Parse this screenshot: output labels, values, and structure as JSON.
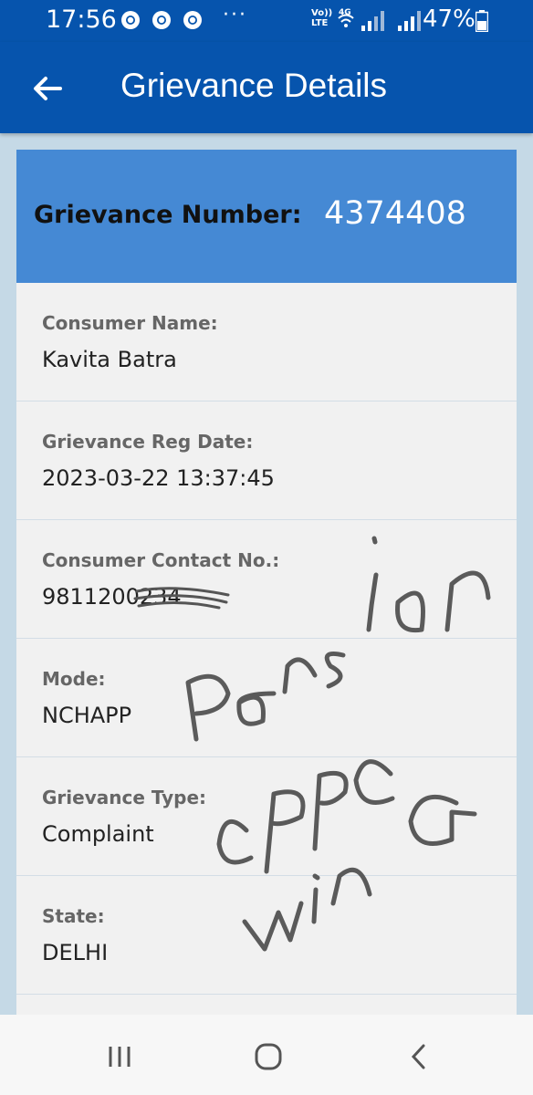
{
  "status_bar": {
    "time": "17:56",
    "more": "···",
    "volte_top": "Vo))",
    "volte_bottom": "LTE",
    "network": "4G",
    "battery": "47%"
  },
  "app_bar": {
    "title": "Grievance Details",
    "back_icon": "arrow-left-icon"
  },
  "grievance": {
    "number_label": "Grievance Number:",
    "number_value": "4374408",
    "fields": [
      {
        "label": "Consumer Name:",
        "value": "Kavita Batra"
      },
      {
        "label": "Grievance Reg Date:",
        "value": "2023-03-22 13:37:45"
      },
      {
        "label": "Consumer Contact No.:",
        "value": "9811200234"
      },
      {
        "label": "Mode:",
        "value": "NCHAPP"
      },
      {
        "label": "Grievance Type:",
        "value": "Complaint"
      },
      {
        "label": "State:",
        "value": "DELHI"
      }
    ]
  },
  "handwriting": {
    "lines": [
      "Pension",
      "CPPC",
      "WinG"
    ]
  },
  "colors": {
    "primary": "#0654ad",
    "card_header": "#4589d4",
    "background": "#c5d9e6",
    "card": "#f1f1f1"
  },
  "nav_bar": {
    "icons": [
      "recent-apps-icon",
      "home-icon",
      "back-icon"
    ]
  }
}
